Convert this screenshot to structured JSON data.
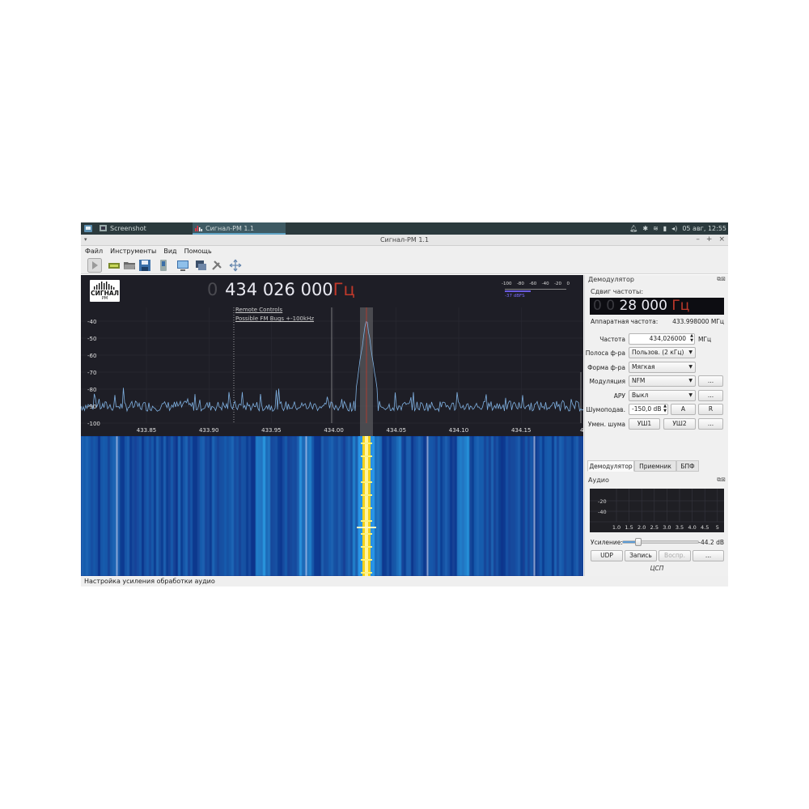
{
  "taskbar": {
    "apps": [
      {
        "label": "Screenshot",
        "icon": "screenshot-icon"
      },
      {
        "label": "Сигнал-РМ 1.1",
        "icon": "signal-app-icon"
      }
    ],
    "clock": "05 авг, 12:55"
  },
  "window": {
    "title": "Сигнал-РМ 1.1",
    "menu_glyph": "▾"
  },
  "menu": [
    "Файл",
    "Инструменты",
    "Вид",
    "Помощь"
  ],
  "toolbar_icons": [
    "play-icon",
    "device-icon",
    "open-icon",
    "save-icon",
    "record-icon",
    "screen-icon",
    "remote-icon",
    "settings-icon",
    "fullscreen-icon"
  ],
  "logo": {
    "line1": "СИГНАЛ",
    "line2": "РМ"
  },
  "frequency": {
    "leading": "0",
    "main": "434 026 000",
    "unit": "Гц",
    "value_mhz": 434.026
  },
  "meter": {
    "ticks": [
      "-100",
      "-80",
      "-60",
      "-40",
      "-20",
      "0"
    ],
    "readout": "-37 dBFS",
    "level_fraction": 0.42
  },
  "bookmarks": [
    "Remote Controls",
    "Possible FM Bugs +-100kHz"
  ],
  "spectrum": {
    "y_ticks": [
      "-40",
      "-50",
      "-60",
      "-70",
      "-80",
      "-90",
      "-100"
    ],
    "x_ticks": [
      "433.85",
      "433.90",
      "433.95",
      "434.00",
      "434.05",
      "434.10",
      "434.15",
      "43"
    ],
    "center_mhz": 434.026,
    "floor_db": -90,
    "peak_db": -38
  },
  "demod": {
    "title": "Демодулятор",
    "offset_label": "Сдвиг частоты:",
    "offset_dim": "0 0",
    "offset_main": "28 000",
    "offset_unit": "Гц",
    "hw_label": "Аппаратная частота:",
    "hw_value": "433.998000 МГц",
    "freq_label": "Частота",
    "freq_value": "434,026000",
    "freq_unit": "МГц",
    "filter_label": "Полоса ф-ра",
    "filter_value": "Пользов. (2 кГц)",
    "shape_label": "Форма ф-ра",
    "shape_value": "Мягкая",
    "mode_label": "Модуляция",
    "mode_value": "NFM",
    "agc_label": "АРУ",
    "agc_value": "Выкл",
    "squelch_label": "Шумоподав.",
    "squelch_value": "-150,0 dB",
    "squelch_auto": "A",
    "squelch_reset": "R",
    "nr_label": "Умен. шума",
    "nb1": "УШ1",
    "nb2": "УШ2",
    "more": "..."
  },
  "tabs": [
    "Демодулятор",
    "Приемник",
    "БПФ"
  ],
  "audio": {
    "title": "Аудио",
    "y_ticks": [
      "-20",
      "-40"
    ],
    "x_ticks": [
      "1.0",
      "1.5",
      "2.0",
      "2.5",
      "3.0",
      "3.5",
      "4.0",
      "4.5",
      "5"
    ],
    "gain_label": "Усиление:",
    "gain_value": "-44.2 dB",
    "gain_fraction": 0.2,
    "buttons": [
      "UDP",
      "Запись",
      "Воспр.",
      "..."
    ],
    "dsp_label": "ЦСП"
  },
  "status": "Настройка усиления обработки аудио",
  "colors": {
    "accent": "#c0392b",
    "trace": "#7fb0e0",
    "waterfall_bg": "#061a7a",
    "bookmark": "#bbbbbb"
  }
}
